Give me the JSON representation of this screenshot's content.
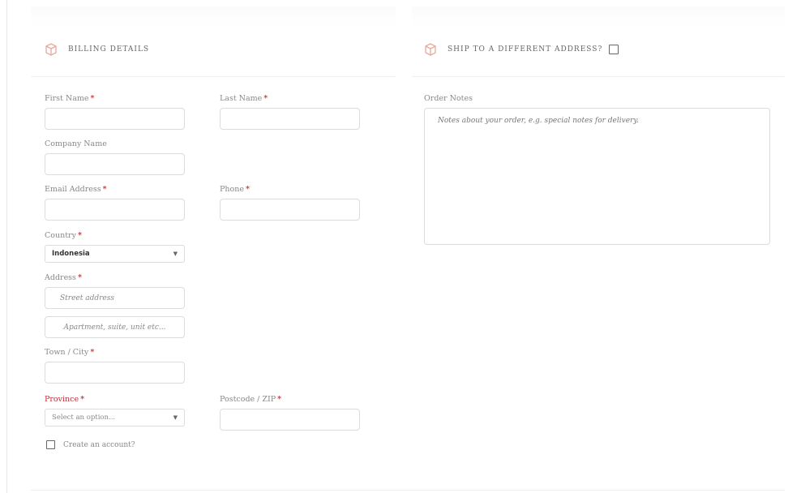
{
  "billing": {
    "section_title": "BILLING DETAILS",
    "first_name_label": "First Name",
    "last_name_label": "Last Name",
    "company_label": "Company Name",
    "email_label": "Email Address",
    "phone_label": "Phone",
    "country_label": "Country",
    "country_value": "Indonesia",
    "address_label": "Address",
    "street_placeholder": "Street address",
    "apartment_placeholder": "Apartment, suite, unit etc...",
    "town_label": "Town / City",
    "province_label": "Province",
    "province_value": "Select an option...",
    "postcode_label": "Postcode / ZIP",
    "create_account_label": "Create an account?",
    "required_mark": "*"
  },
  "shipping": {
    "section_title": "SHIP TO A DIFFERENT ADDRESS?",
    "order_notes_label": "Order Notes",
    "order_notes_placeholder": "Notes about your order, e.g. special notes for delivery."
  },
  "colors": {
    "accent": "#e08b7e",
    "required": "#c9303a",
    "border": "#dcdcdc"
  },
  "icons": {
    "billing": "package-icon",
    "shipping": "package-icon"
  }
}
